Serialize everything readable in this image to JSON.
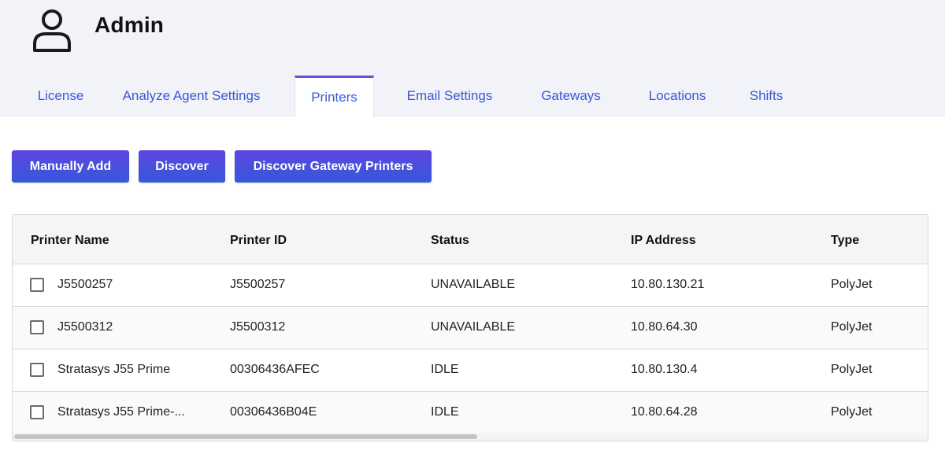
{
  "header": {
    "title": "Admin",
    "icon": "user-icon"
  },
  "tabs": [
    {
      "label": "License",
      "active": false
    },
    {
      "label": "Analyze Agent Settings",
      "active": false
    },
    {
      "label": "Printers",
      "active": true
    },
    {
      "label": "Email Settings",
      "active": false
    },
    {
      "label": "Gateways",
      "active": false
    },
    {
      "label": "Locations",
      "active": false
    },
    {
      "label": "Shifts",
      "active": false
    }
  ],
  "toolbar": {
    "manually_add_label": "Manually Add",
    "discover_label": "Discover",
    "discover_gateway_label": "Discover Gateway Printers"
  },
  "table": {
    "columns": [
      "Printer Name",
      "Printer ID",
      "Status",
      "IP Address",
      "Type"
    ],
    "rows": [
      {
        "name": "J5500257",
        "id": "J5500257",
        "status": "UNAVAILABLE",
        "ip": "10.80.130.21",
        "type": "PolyJet",
        "checked": false
      },
      {
        "name": "J5500312",
        "id": "J5500312",
        "status": "UNAVAILABLE",
        "ip": "10.80.64.30",
        "type": "PolyJet",
        "checked": false
      },
      {
        "name": "Stratasys J55 Prime",
        "id": "00306436AFEC",
        "status": "IDLE",
        "ip": "10.80.130.4",
        "type": "PolyJet",
        "checked": false
      },
      {
        "name": "Stratasys J55 Prime-...",
        "id": "00306436B04E",
        "status": "IDLE",
        "ip": "10.80.64.28",
        "type": "PolyJet",
        "checked": false
      }
    ]
  },
  "colors": {
    "accent": "#3a57d6",
    "button_gradient_top": "#5d45e0",
    "button_gradient_bottom": "#3559d9",
    "header_bg": "#f1f3f9"
  }
}
